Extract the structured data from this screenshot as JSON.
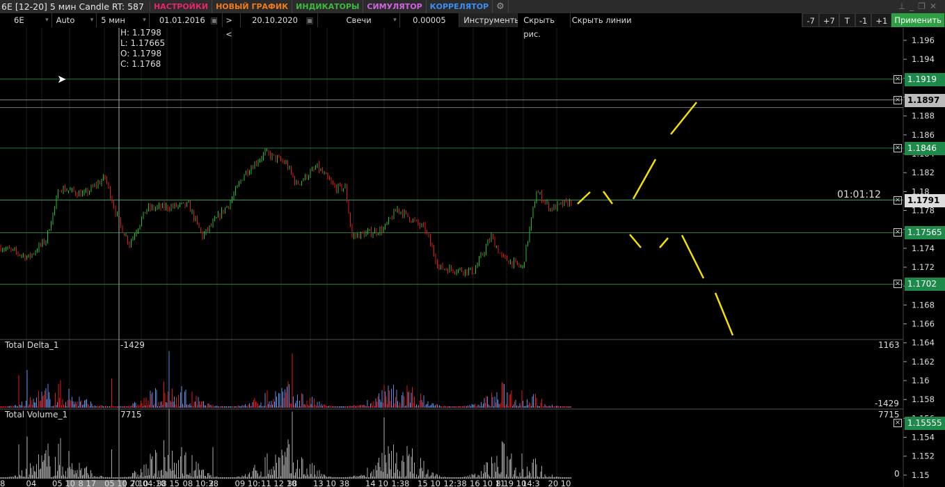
{
  "title": "6E [12-20] 5 мин Candle RT: 587",
  "menu": [
    {
      "label": "НАСТРОЙКИ",
      "color": "#e8246c"
    },
    {
      "label": "НОВЫЙ ГРАФИК",
      "color": "#f07b1a"
    },
    {
      "label": "ИНДИКАТОРЫ",
      "color": "#3cba3c"
    },
    {
      "label": "СИМУЛЯТОР",
      "color": "#d065e0"
    },
    {
      "label": "КОРРЕЛЯТОР",
      "color": "#3a8ef0"
    }
  ],
  "toolbar": {
    "symbol": "6E",
    "scale": "Auto",
    "timeframe": "5 мин",
    "date_from": "01.01.2016",
    "nav": "> <",
    "date_to": "20.10.2020",
    "chart_type": "Свечи",
    "tick": "0.00005",
    "instruments": "Инструменты",
    "hide_drawings": "Скрыть рис.",
    "hide_lines": "Скрыть линии",
    "buttons": [
      "-7",
      "+7",
      "T",
      "-1",
      "+1"
    ],
    "apply": "Применить"
  },
  "ohlc": {
    "h": "H: 1.1798",
    "l": "L: 1.17665",
    "o": "O: 1.1798",
    "c": "C: 1.1768"
  },
  "timer": "01:01:12",
  "price_axis": {
    "max": 1.196,
    "min": 1.15,
    "step": 0.002
  },
  "levels": [
    {
      "price": 1.1919,
      "label": "1.1919",
      "color": "#1e8a4a"
    },
    {
      "price": 1.1897,
      "label": "1.1897",
      "color": "#bbbbbb"
    },
    {
      "price": 1.1846,
      "label": "1.1846",
      "color": "#1e8a4a"
    },
    {
      "price": 1.1791,
      "label": "1.1791",
      "color": "#dddddd"
    },
    {
      "price": 1.17565,
      "label": "1.17565",
      "color": "#1e8a4a"
    },
    {
      "price": 1.1702,
      "label": "1.1702",
      "color": "#1e8a4a"
    },
    {
      "price": 1.15555,
      "label": "1.15555",
      "color": "#1e8a4a"
    }
  ],
  "price_path": [
    [
      0,
      1.17414
    ],
    [
      16,
      1.17304
    ],
    [
      26,
      1.17488
    ],
    [
      34,
      1.1804
    ],
    [
      48,
      1.17966
    ],
    [
      60,
      1.1815
    ],
    [
      68,
      1.17672
    ],
    [
      74,
      1.17451
    ],
    [
      84,
      1.17819
    ],
    [
      108,
      1.17856
    ],
    [
      116,
      1.17525
    ],
    [
      132,
      1.17892
    ],
    [
      140,
      1.18187
    ],
    [
      152,
      1.18408
    ],
    [
      164,
      1.18297
    ],
    [
      170,
      1.18076
    ],
    [
      182,
      1.1826
    ],
    [
      192,
      1.1804
    ],
    [
      198,
      1.1804
    ],
    [
      202,
      1.17525
    ],
    [
      220,
      1.17598
    ],
    [
      228,
      1.17819
    ],
    [
      244,
      1.17598
    ],
    [
      252,
      1.17193
    ],
    [
      272,
      1.17156
    ],
    [
      282,
      1.17525
    ],
    [
      288,
      1.17304
    ],
    [
      300,
      1.17193
    ],
    [
      308,
      1.18003
    ],
    [
      316,
      1.17819
    ],
    [
      328,
      1.17892
    ]
  ],
  "delta": {
    "title": "Total Delta_1",
    "cursor_value": "-1429",
    "max_label": "1163",
    "min_label": "-1429"
  },
  "volume": {
    "title": "Total Volume_1",
    "cursor_value": "7715",
    "max_label": "7715",
    "min_label": "0"
  },
  "time_labels": [
    "8",
    "04",
    "05 10",
    "8 17",
    "05 10 20 04:10",
    "7 10",
    "38 15",
    "08 10:38",
    "2",
    "09 10:",
    "11 12 10",
    "38",
    "13 10",
    "38",
    "14 10",
    "1:38",
    "15 10",
    "12:38",
    "16 10 11",
    "8 19 10",
    "14:3",
    "20 10"
  ]
}
